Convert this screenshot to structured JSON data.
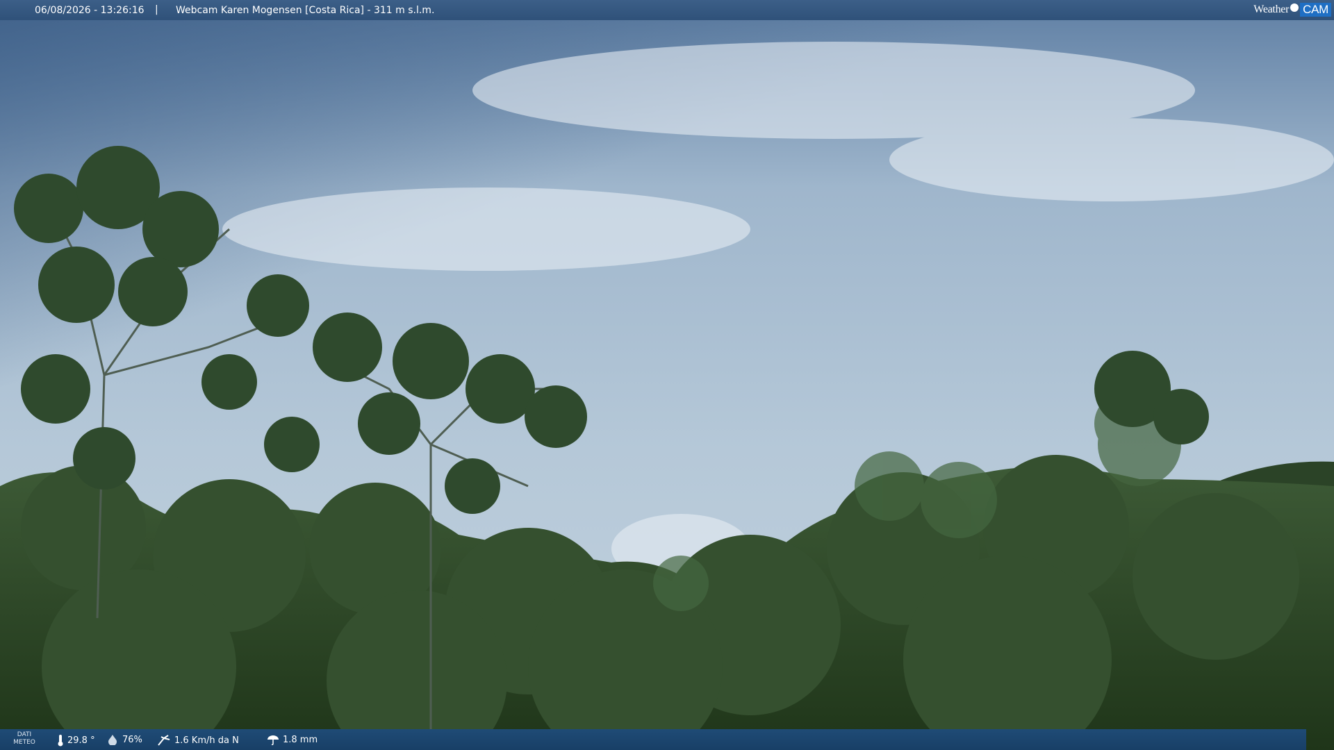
{
  "overlay": {
    "datetime": "06/08/2026 - 13:26:16",
    "separator": "|",
    "title": "Webcam Karen Mogensen [Costa Rica]  - 311 m s.l.m.",
    "logo_weather": "Weather",
    "logo_cam": "CAM"
  },
  "weather": {
    "label": "DATI METEO",
    "temperature": "29.8 °",
    "humidity": "76%",
    "wind": "1.6 Km/h da N",
    "rain": "1.8 mm"
  },
  "icons": {
    "temperature": "thermometer-icon",
    "humidity": "humidity-drop-icon",
    "wind": "wind-icon",
    "rain": "rain-icon"
  },
  "colors": {
    "topbar": "#33557e",
    "bottombar": "#1b4470",
    "sky": "#a9bfd2",
    "foliage": "#2f4b2a"
  }
}
